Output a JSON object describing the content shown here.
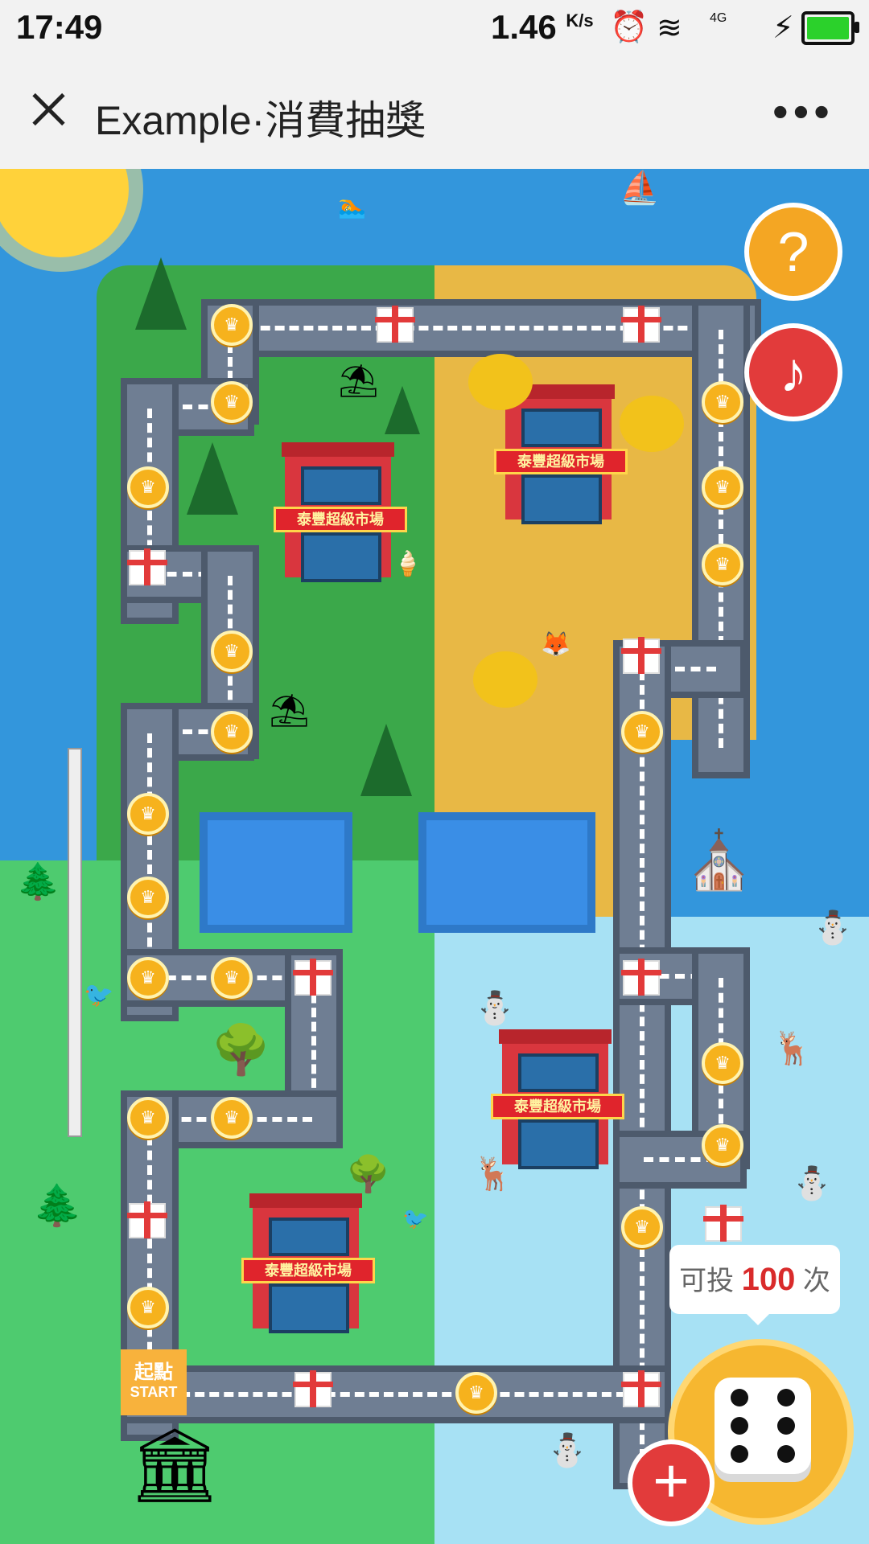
{
  "status_bar": {
    "time": "17:49",
    "net_speed": "1.46",
    "net_unit": "K/s",
    "network": "4G",
    "battery": "full"
  },
  "title_bar": {
    "title": "Example·消費抽獎",
    "close_icon": "close-icon",
    "more_icon": "more-icon"
  },
  "board": {
    "store_sign": "泰豐超級市場",
    "start_zh": "起點",
    "start_en": "START"
  },
  "controls": {
    "help_label": "?",
    "music_label": "♪",
    "rolls_prefix": "可投",
    "rolls_count": "100",
    "rolls_suffix": "次",
    "add_label": "+"
  },
  "colors": {
    "accent": "#f6b730",
    "danger": "#e23b3b",
    "road": "#6f7e93"
  }
}
